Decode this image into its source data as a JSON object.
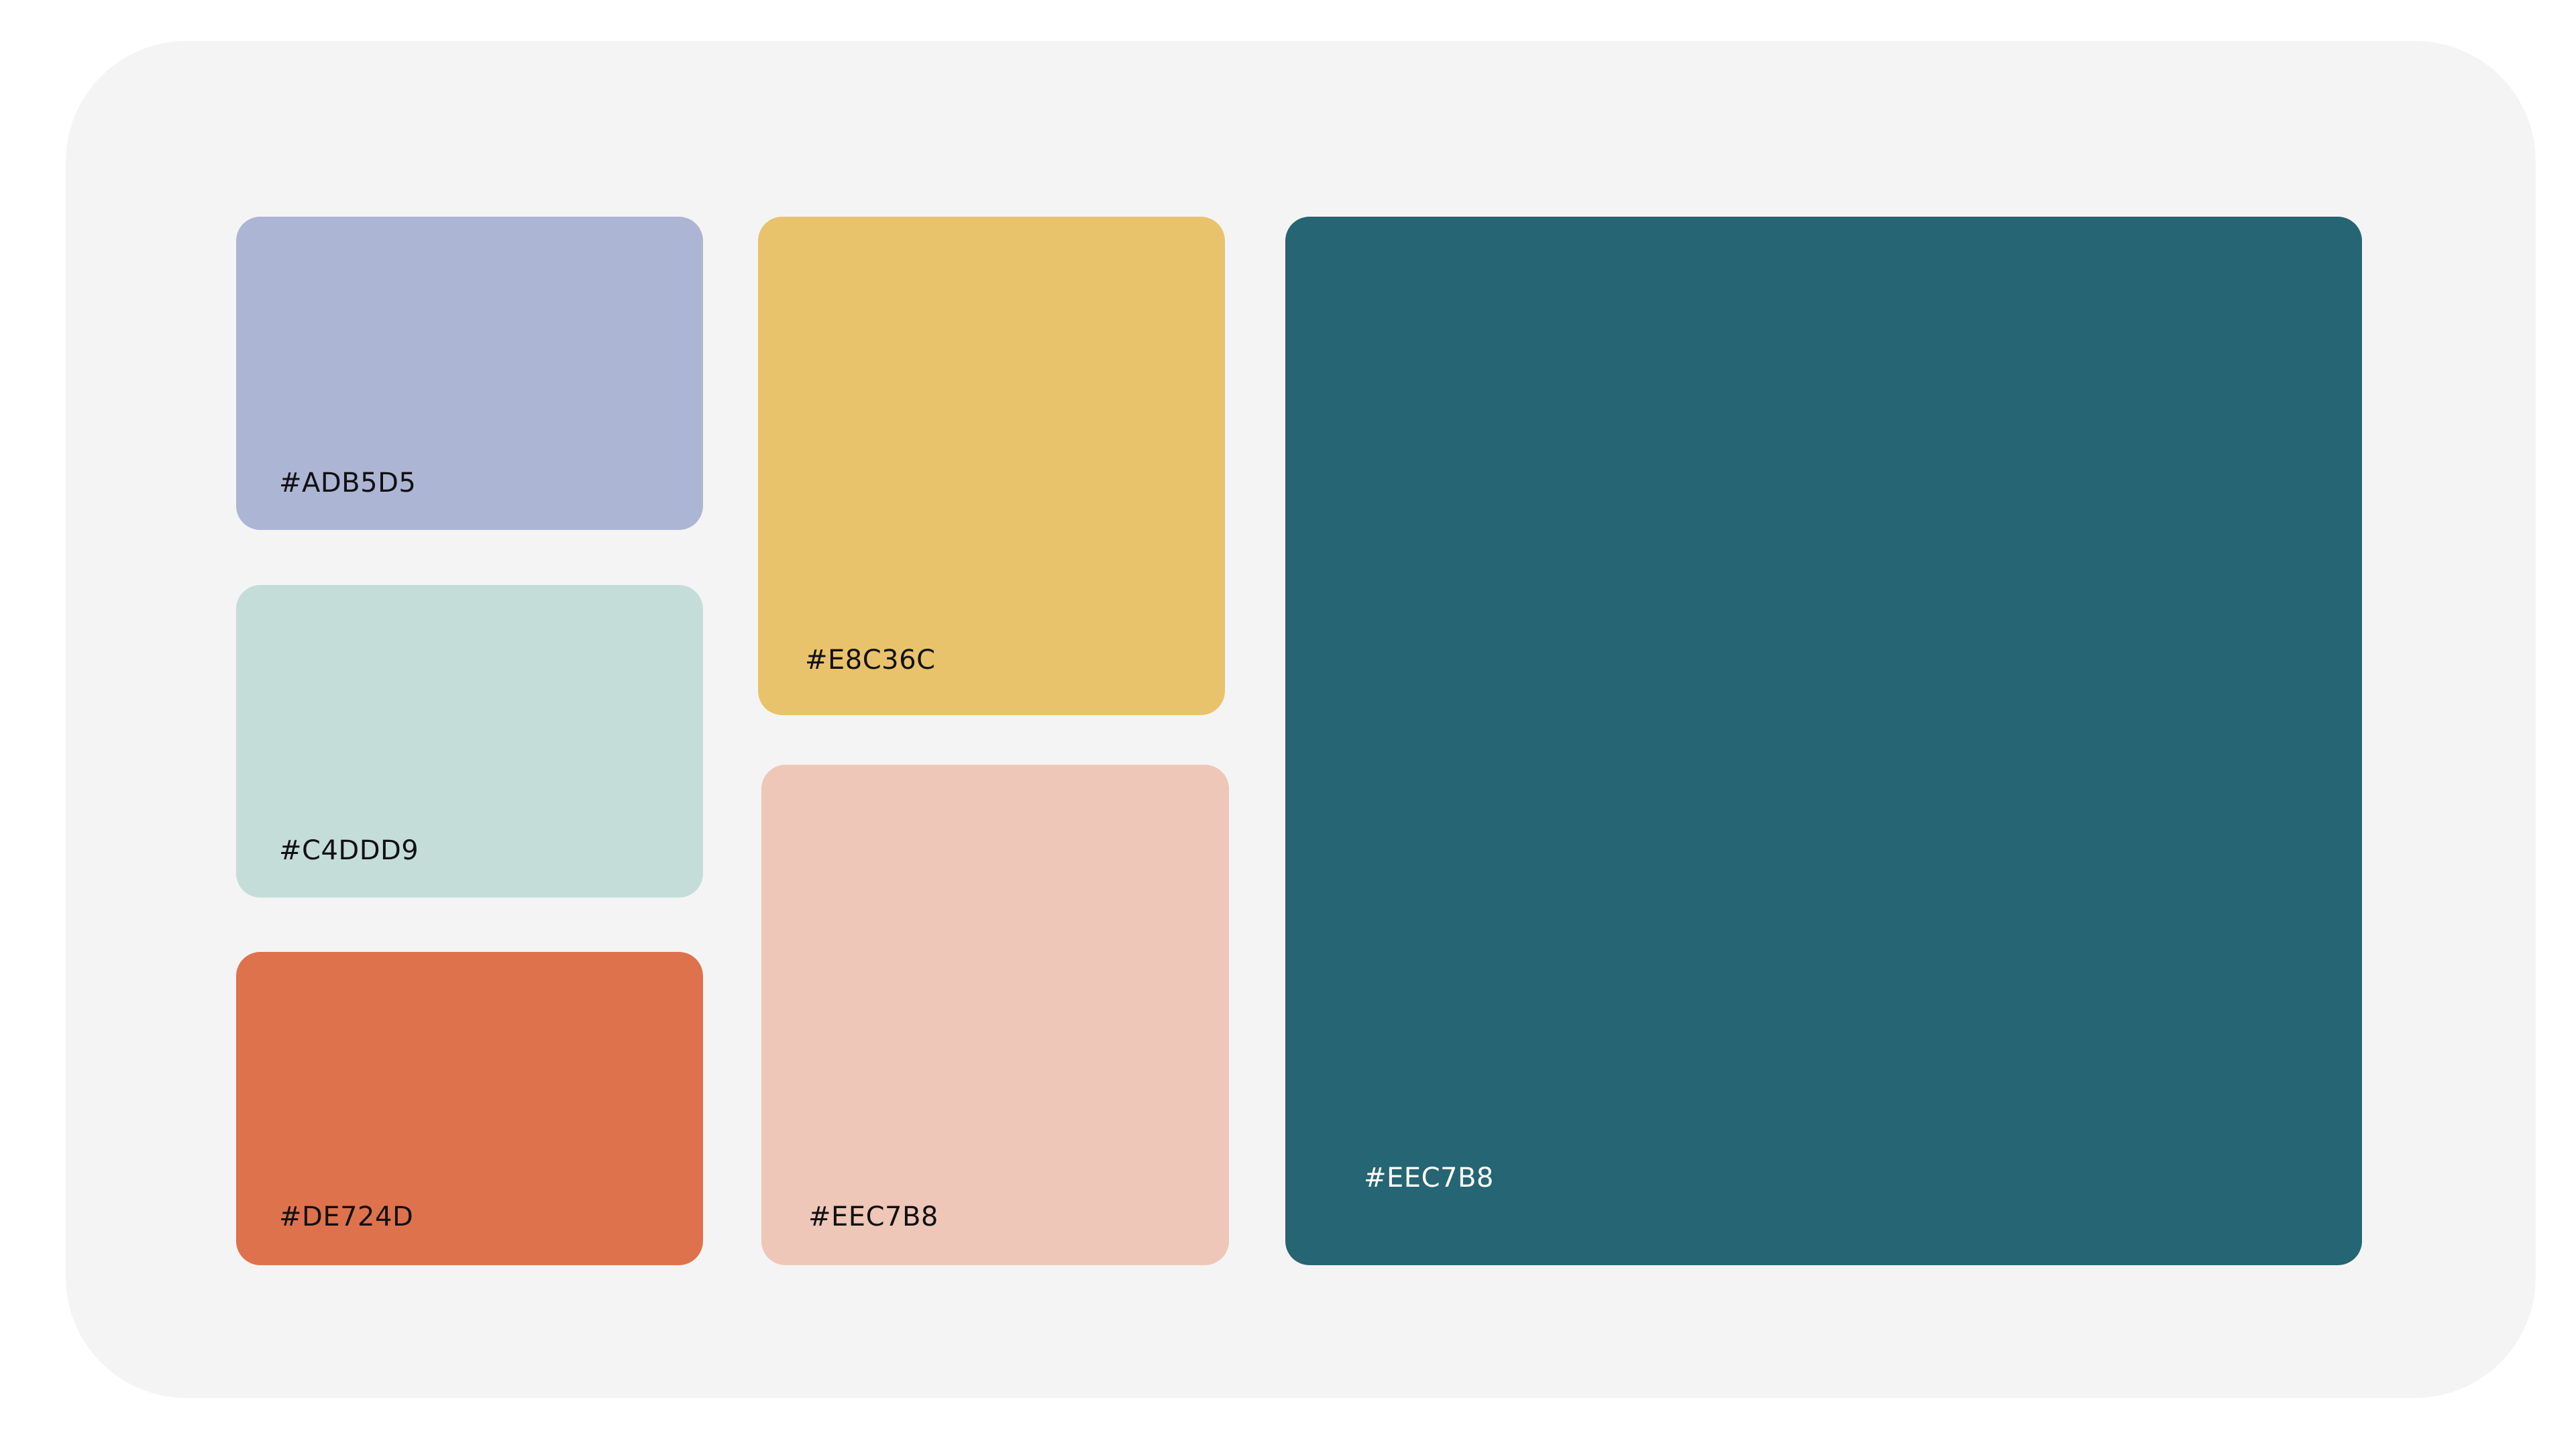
{
  "palette": {
    "background": "#F4F4F4",
    "swatches": [
      {
        "id": "lavender",
        "label": "#ADB5D5",
        "color": "#ADB5D5",
        "text_color": "#111111"
      },
      {
        "id": "mint",
        "label": "#C4DDD9",
        "color": "#C4DDD9",
        "text_color": "#111111"
      },
      {
        "id": "orange",
        "label": "#DE724D",
        "color": "#DE724D",
        "text_color": "#111111"
      },
      {
        "id": "yellow",
        "label": "#E8C36C",
        "color": "#E8C36C",
        "text_color": "#111111"
      },
      {
        "id": "blush",
        "label": "#EEC7B8",
        "color": "#EEC7B8",
        "text_color": "#111111"
      },
      {
        "id": "teal",
        "label": "#EEC7B8",
        "color": "#266573",
        "text_color": "#FFFFFF"
      }
    ]
  }
}
